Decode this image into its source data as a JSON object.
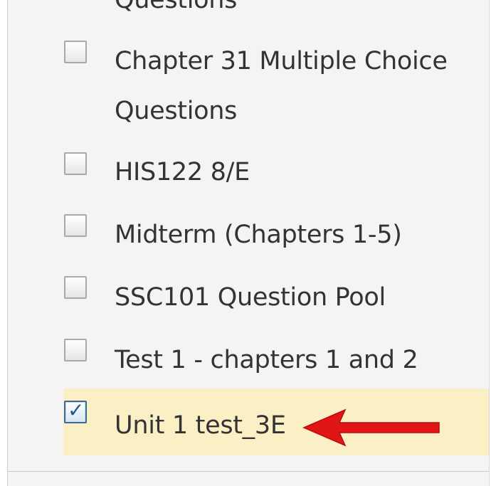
{
  "question_pools": {
    "cut_off_top_text": "Questions",
    "items": [
      {
        "label_line1": "Chapter 31 Multiple Choice",
        "label_line2": "Questions",
        "checked": false
      },
      {
        "label": "HIS122 8/E",
        "checked": false
      },
      {
        "label": "Midterm (Chapters 1-5)",
        "checked": false
      },
      {
        "label": "SSC101 Question Pool",
        "checked": false
      },
      {
        "label": "Test 1 - chapters 1 and 2",
        "checked": false
      },
      {
        "label": "Unit 1 test_3E",
        "checked": true,
        "highlighted": true
      }
    ]
  },
  "annotation": {
    "icon": "red-arrow-icon",
    "color": "#e01616"
  },
  "colors": {
    "panel_background": "#f4f4f4",
    "selected_row_background": "#fbefc5",
    "checkbox_checked_border": "#3b6c96",
    "text": "#333333"
  }
}
